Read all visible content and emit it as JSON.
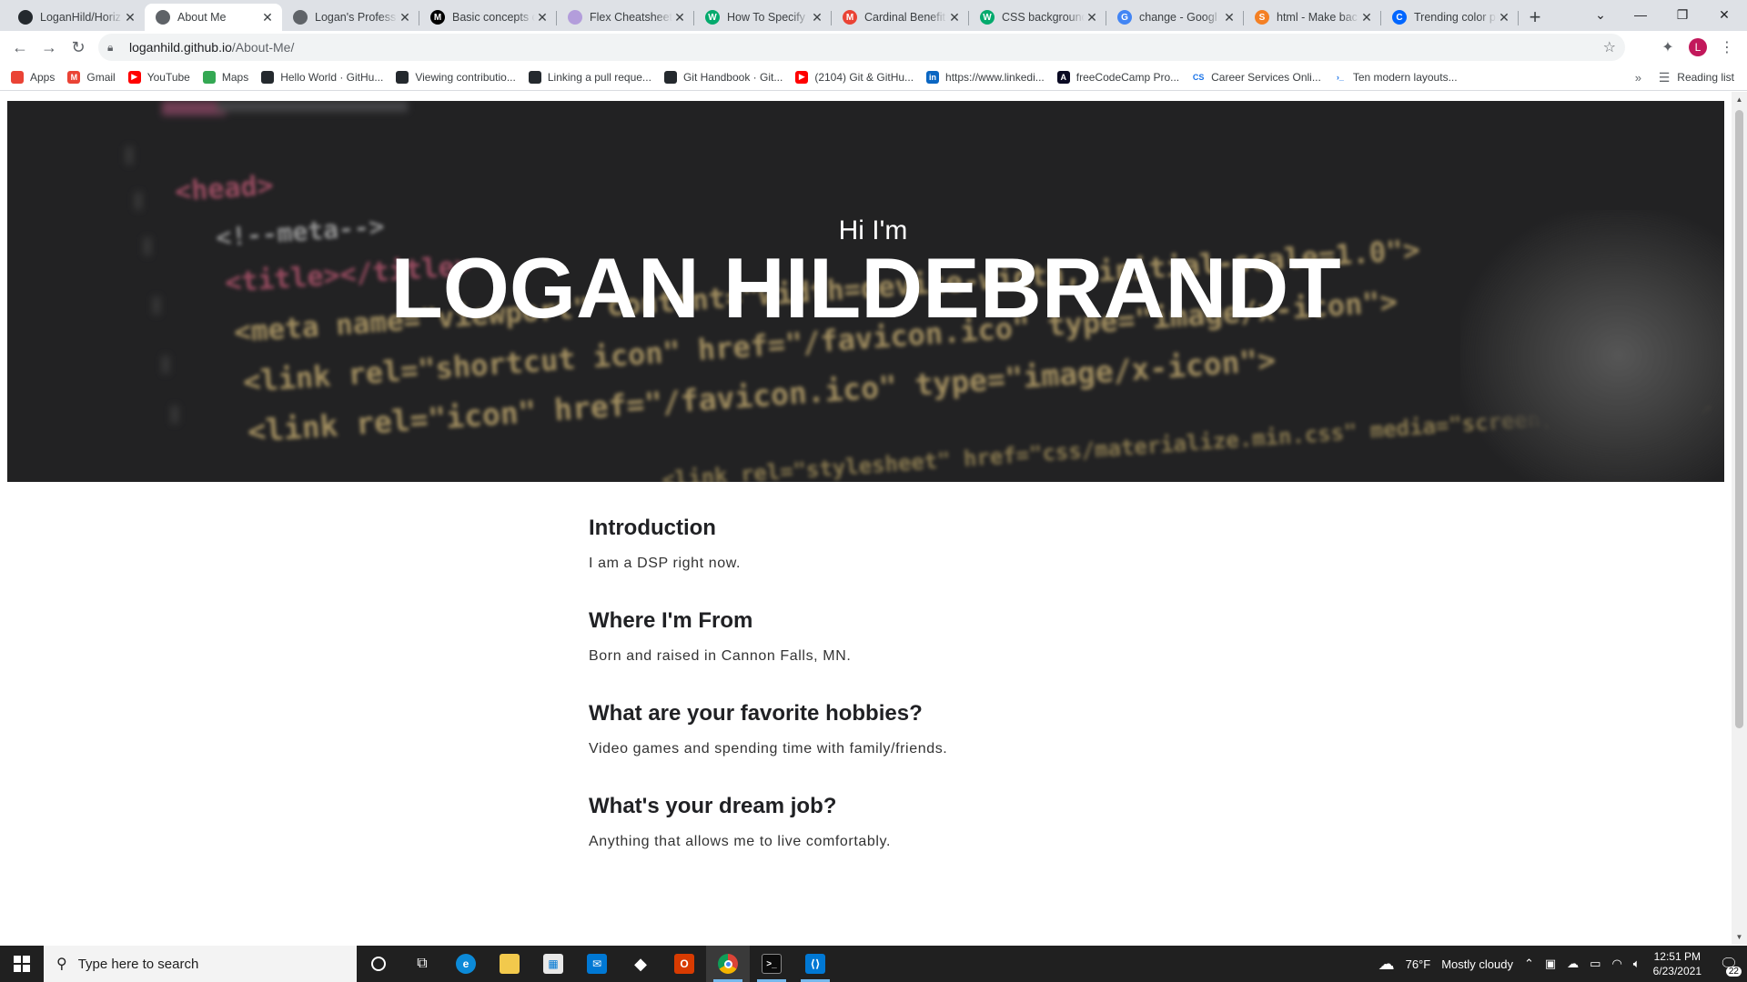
{
  "tabs": [
    {
      "title": "LoganHild/Horiz",
      "icon": "github-icon",
      "color": "#24292e",
      "glyph": ""
    },
    {
      "title": "About Me",
      "icon": "globe-icon",
      "color": "#5f6368",
      "glyph": "",
      "active": true
    },
    {
      "title": "Logan's Profess",
      "icon": "globe-icon",
      "color": "#5f6368",
      "glyph": ""
    },
    {
      "title": "Basic concepts o",
      "icon": "mdn-icon",
      "color": "#000000",
      "glyph": "M"
    },
    {
      "title": "Flex Cheatsheet",
      "icon": "flex-icon",
      "color": "#b39ddb",
      "glyph": ""
    },
    {
      "title": "How To Specify",
      "icon": "w3-icon",
      "color": "#04aa6d",
      "glyph": "W"
    },
    {
      "title": "Cardinal Benefit",
      "icon": "gmail-icon",
      "color": "#ea4335",
      "glyph": "M"
    },
    {
      "title": "CSS background",
      "icon": "w3-icon",
      "color": "#04aa6d",
      "glyph": "W"
    },
    {
      "title": "change - Googl",
      "icon": "google-icon",
      "color": "#4285f4",
      "glyph": "G"
    },
    {
      "title": "html - Make bac",
      "icon": "stackoverflow-icon",
      "color": "#f48024",
      "glyph": "S"
    },
    {
      "title": "Trending color p",
      "icon": "coolors-icon",
      "color": "#0066ff",
      "glyph": "C"
    }
  ],
  "address": {
    "host": "loganhild.github.io",
    "path": "/About-Me/"
  },
  "profile_initial": "L",
  "bookmarks": [
    {
      "label": "Apps",
      "icon": "apps-icon",
      "color": "#ea4335",
      "glyph": ""
    },
    {
      "label": "Gmail",
      "icon": "gmail-icon",
      "color": "#ea4335",
      "glyph": "M"
    },
    {
      "label": "YouTube",
      "icon": "youtube-icon",
      "color": "#ff0000",
      "glyph": "▶"
    },
    {
      "label": "Maps",
      "icon": "maps-icon",
      "color": "#34a853",
      "glyph": ""
    },
    {
      "label": "Hello World · GitHu...",
      "icon": "github-icon",
      "color": "#24292e",
      "glyph": ""
    },
    {
      "label": "Viewing contributio...",
      "icon": "github-icon",
      "color": "#24292e",
      "glyph": ""
    },
    {
      "label": "Linking a pull reque...",
      "icon": "github-icon",
      "color": "#24292e",
      "glyph": ""
    },
    {
      "label": "Git Handbook · Git...",
      "icon": "github-icon",
      "color": "#24292e",
      "glyph": ""
    },
    {
      "label": "(2104) Git & GitHu...",
      "icon": "youtube-icon",
      "color": "#ff0000",
      "glyph": "▶"
    },
    {
      "label": "https://www.linkedi...",
      "icon": "linkedin-icon",
      "color": "#0a66c2",
      "glyph": "in"
    },
    {
      "label": "freeCodeCamp Pro...",
      "icon": "freecodecamp-icon",
      "color": "#0a0a23",
      "glyph": "A"
    },
    {
      "label": "Career Services Onli...",
      "icon": "career-services-icon",
      "color": "#ffffff",
      "glyph": "CS"
    },
    {
      "label": "Ten modern layouts...",
      "icon": "terminal-icon",
      "color": "#ffffff",
      "glyph": "›_"
    }
  ],
  "reading_list": "Reading list",
  "hero": {
    "greeting": "Hi I'm",
    "name": "LOGAN HILDEBRANDT",
    "code_lines": [
      "<head>",
      "<!--meta-->",
      "<title></title>",
      "<meta name=\"viewport\" content=\"width=device-width, initial-scale=1.0\">",
      "<link rel=\"shortcut icon\" href=\"/favicon.ico\" type=\"image/x-icon\">",
      "<link rel=\"icon\" href=\"/favicon.ico\" type=\"image/x-icon\">",
      "<link rel=\"stylesheet\" href=\"css/materialize.min.css\" media=\"screen,projection\">"
    ]
  },
  "sections": [
    {
      "heading": "Introduction",
      "text": "I am a DSP right now."
    },
    {
      "heading": "Where I'm From",
      "text": "Born and raised in Cannon Falls, MN."
    },
    {
      "heading": "What are your favorite hobbies?",
      "text": "Video games and spending time with family/friends."
    },
    {
      "heading": "What's your dream job?",
      "text": "Anything that allows me to live comfortably."
    }
  ],
  "taskbar": {
    "search_placeholder": "Type here to search",
    "weather_temp": "76°F",
    "weather_text": "Mostly cloudy",
    "time": "12:51 PM",
    "date": "6/23/2021",
    "notification_count": "22"
  }
}
